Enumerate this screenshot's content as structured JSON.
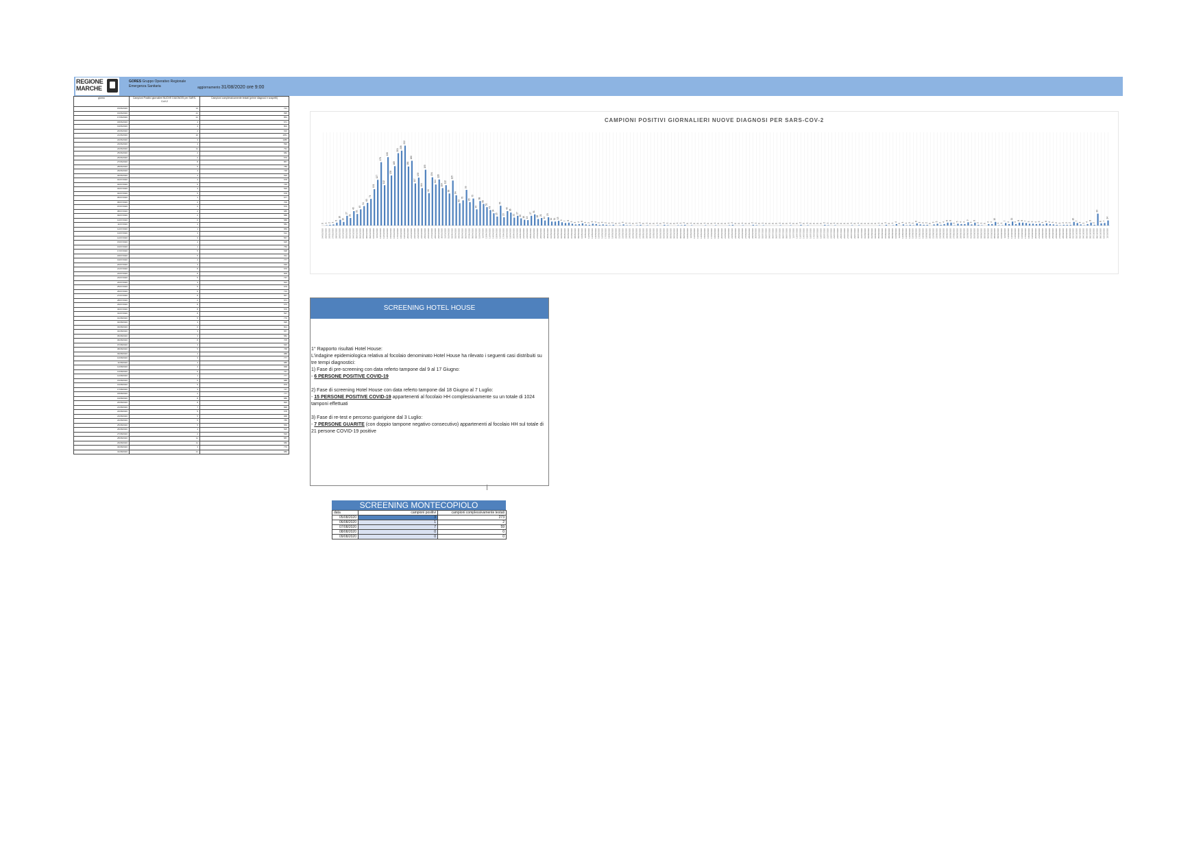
{
  "header": {
    "logo_text": [
      "REGIONE",
      "MARCHE"
    ],
    "gores_bold": "GORES",
    "gores_text": " Gruppo Operativo Regionale Emergenza Sanitaria",
    "update_prefix": "aggiornamento",
    "update_date": "31/08/2020 ore 9:00"
  },
  "left_table": {
    "headers": [
      "giorno",
      "Campioni Positivi giornalieri NUOVE DIAGNOSI per SARS-CoV-2",
      "Campioni complessivamente testati (prime diagnosi e sospetti)"
    ],
    "rows": [
      [
        "15/06/2020",
        "14",
        "721"
      ],
      [
        "16/06/2020",
        "21",
        "995"
      ],
      [
        "17/06/2020",
        "21",
        "853"
      ],
      [
        "18/06/2020",
        "4",
        "671"
      ],
      [
        "19/06/2020",
        "4",
        "802"
      ],
      [
        "20/06/2020",
        "2",
        "916"
      ],
      [
        "21/06/2020",
        "10",
        "1051"
      ],
      [
        "22/06/2020",
        "3",
        "1085"
      ],
      [
        "23/06/2020",
        "4",
        "590"
      ],
      [
        "24/06/2020",
        "11",
        "791"
      ],
      [
        "25/06/2020",
        "2",
        "682"
      ],
      [
        "26/06/2020",
        "2",
        "576"
      ],
      [
        "27/06/2020",
        "8",
        "857"
      ],
      [
        "28/06/2020",
        "5",
        "786"
      ],
      [
        "29/06/2020",
        "4",
        "748"
      ],
      [
        "30/06/2020",
        "4",
        "526"
      ],
      [
        "01/07/2020",
        "4",
        "678"
      ],
      [
        "02/07/2020",
        "6",
        "725"
      ],
      [
        "03/07/2020",
        "4",
        "526"
      ],
      [
        "04/07/2020",
        "5",
        "678"
      ],
      [
        "05/07/2020",
        "1",
        "677"
      ],
      [
        "06/07/2020",
        "2",
        "700"
      ],
      [
        "07/07/2020",
        "2",
        "570"
      ],
      [
        "08/07/2020",
        "2",
        "685"
      ],
      [
        "09/07/2020",
        "2",
        "588"
      ],
      [
        "10/07/2020",
        "6",
        "588"
      ],
      [
        "11/07/2020",
        "4",
        "582"
      ],
      [
        "12/07/2020",
        "1",
        "659"
      ],
      [
        "13/07/2020",
        "3",
        "612"
      ],
      [
        "14/07/2020",
        "3",
        "567"
      ],
      [
        "15/07/2020",
        "4",
        "625"
      ],
      [
        "16/07/2020",
        "1",
        "756"
      ],
      [
        "17/07/2020",
        "5",
        "638"
      ],
      [
        "18/07/2020",
        "5",
        "611"
      ],
      [
        "19/07/2020",
        "4",
        "777"
      ],
      [
        "20/07/2020",
        "3",
        "639"
      ],
      [
        "21/07/2020",
        "8",
        "676"
      ],
      [
        "22/07/2020",
        "8",
        "605"
      ],
      [
        "23/07/2020",
        "5",
        "737"
      ],
      [
        "24/07/2020",
        "3",
        "523"
      ],
      [
        "25/07/2020",
        "5",
        "679"
      ],
      [
        "26/07/2020",
        "6",
        "713"
      ],
      [
        "27/07/2020",
        "8",
        "567"
      ],
      [
        "28/07/2020",
        "2",
        "671"
      ],
      [
        "29/07/2020",
        "8",
        "675"
      ],
      [
        "30/07/2020",
        "8",
        "576"
      ],
      [
        "31/07/2020",
        "8",
        "597"
      ],
      [
        "01/08/2020",
        "5",
        "776"
      ],
      [
        "02/08/2020",
        "3",
        "695"
      ],
      [
        "03/08/2020",
        "6",
        "601"
      ],
      [
        "04/08/2020",
        "3",
        "657"
      ],
      [
        "05/08/2020",
        "3",
        "582"
      ],
      [
        "06/08/2020",
        "8",
        "705"
      ],
      [
        "07/08/2020",
        "3",
        "545"
      ],
      [
        "08/08/2020",
        "5",
        "768"
      ],
      [
        "09/08/2020",
        "4",
        "988"
      ],
      [
        "10/08/2020",
        "3",
        "777"
      ],
      [
        "11/08/2020",
        "4",
        "685"
      ],
      [
        "12/08/2020",
        "4",
        "668"
      ],
      [
        "13/08/2020",
        "6",
        "767"
      ],
      [
        "14/08/2020",
        "1",
        "777"
      ],
      [
        "15/08/2020",
        "5",
        "688"
      ],
      [
        "16/08/2020",
        "5",
        "878"
      ],
      [
        "17/08/2020",
        "3",
        "747"
      ],
      [
        "18/08/2020",
        "2",
        "777"
      ],
      [
        "19/08/2020",
        "8",
        "686"
      ],
      [
        "20/08/2020",
        "8",
        "826"
      ],
      [
        "21/08/2020",
        "7",
        "848"
      ],
      [
        "22/08/2020",
        "5",
        "678"
      ],
      [
        "23/08/2020",
        "5",
        "968"
      ],
      [
        "24/08/2020",
        "5",
        "786"
      ],
      [
        "25/08/2020",
        "5",
        "569"
      ],
      [
        "26/08/2020",
        "4",
        "525"
      ],
      [
        "27/08/2020",
        "2",
        "526"
      ],
      [
        "28/08/2020",
        "11",
        "587"
      ],
      [
        "29/08/2020",
        "11",
        "680"
      ],
      [
        "30/08/2020",
        "3",
        "776"
      ],
      [
        "31/08/2020",
        "21",
        "689"
      ]
    ]
  },
  "chart_data": {
    "type": "bar",
    "title": "CAMPIONI POSITIVI GIORNALIERI NUOVE DIAGNOSI PER SARS-COV-2",
    "xlabel": "",
    "ylabel": "",
    "ylim": [
      0,
      240
    ],
    "first_date": "24/02/2020",
    "values": [
      0,
      1,
      2,
      3,
      8,
      16,
      10,
      27,
      21,
      40,
      32,
      45,
      54,
      63,
      74,
      101,
      127,
      176,
      112,
      190,
      139,
      165,
      201,
      208,
      222,
      164,
      180,
      117,
      133,
      104,
      155,
      90,
      134,
      114,
      128,
      104,
      112,
      89,
      125,
      84,
      62,
      70,
      99,
      65,
      75,
      45,
      68,
      60,
      51,
      43,
      34,
      25,
      55,
      23,
      40,
      36,
      22,
      27,
      20,
      16,
      15,
      27,
      31,
      18,
      21,
      14,
      23,
      11,
      11,
      13,
      9,
      7,
      8,
      5,
      3,
      4,
      6,
      3,
      2,
      5,
      4,
      2,
      3,
      2,
      1,
      2,
      0,
      1,
      3,
      1,
      1,
      0,
      1,
      2,
      0,
      1,
      0,
      0,
      1,
      0,
      2,
      1,
      0,
      0,
      1,
      1,
      2,
      0,
      1,
      0,
      0,
      0,
      1,
      0,
      0,
      1,
      0,
      0,
      0,
      1,
      2,
      0,
      0,
      1,
      0,
      0,
      2,
      1,
      0,
      1,
      0,
      0,
      0,
      0,
      1,
      0,
      0,
      1,
      0,
      0,
      2,
      0,
      1,
      0,
      0,
      0,
      0,
      2,
      1,
      0,
      1,
      0,
      0,
      0,
      0,
      1,
      0,
      1,
      0,
      0,
      0,
      0,
      0,
      1,
      0,
      2,
      0,
      1,
      4,
      0,
      3,
      1,
      2,
      1,
      6,
      3,
      2,
      2,
      0,
      3,
      5,
      2,
      4,
      8,
      8,
      1,
      5,
      4,
      4,
      9,
      3,
      8,
      2,
      1,
      0,
      4,
      4,
      10,
      1,
      1,
      7,
      4,
      11,
      4,
      8,
      8,
      7,
      5,
      5,
      4,
      5,
      3,
      6,
      4,
      3,
      2,
      1,
      2,
      2,
      2,
      10,
      7,
      3,
      1,
      4,
      8,
      2,
      33,
      6,
      7,
      14
    ]
  },
  "hotel_house": {
    "title": "SCREENING HOTEL HOUSE",
    "lines": [
      "1° Rapporto risultati Hotel House:",
      "L'indagine epidemiologica relativa al focolaio denominato Hotel House ha rilevato i seguenti casi distribuiti su tre tempi diagnostici:",
      "1) Fase di pre-screening con data referto tampone dal 9 al 17 Giugno:",
      "- ",
      "6 PERSONE POSITIVE COVID-19",
      "2) Fase di screening Hotel House con data referto tampone dal 18 Giugno al 7 Luglio:",
      "- ",
      "15 PERSONE POSITIVE COVID-19",
      " appartenenti al focolaio HH complessivamente su un totale di 1024 tamponi effettuati",
      "3) Fase di re-test e percorso guarigione dal 3 Luglio:",
      "- ",
      "7 PERSONE GUARITE",
      " (con doppio tampone negativo consecutivo) appartenenti al focolaio HH sul totale di 21 persone COVID-19 positive"
    ]
  },
  "montecopiolo": {
    "title": "SCREENING MONTECOPIOLO",
    "headers": [
      "data",
      "campioni positivi",
      "campioni complessivamente testati"
    ],
    "rows": [
      [
        "05/08/2020",
        "3",
        "273"
      ],
      [
        "06/08/2020",
        "1",
        "2"
      ],
      [
        "07/08/2020",
        "7",
        "59"
      ],
      [
        "08/08/2020",
        "0",
        "0"
      ],
      [
        "09/08/2020",
        "0",
        "0"
      ]
    ]
  }
}
